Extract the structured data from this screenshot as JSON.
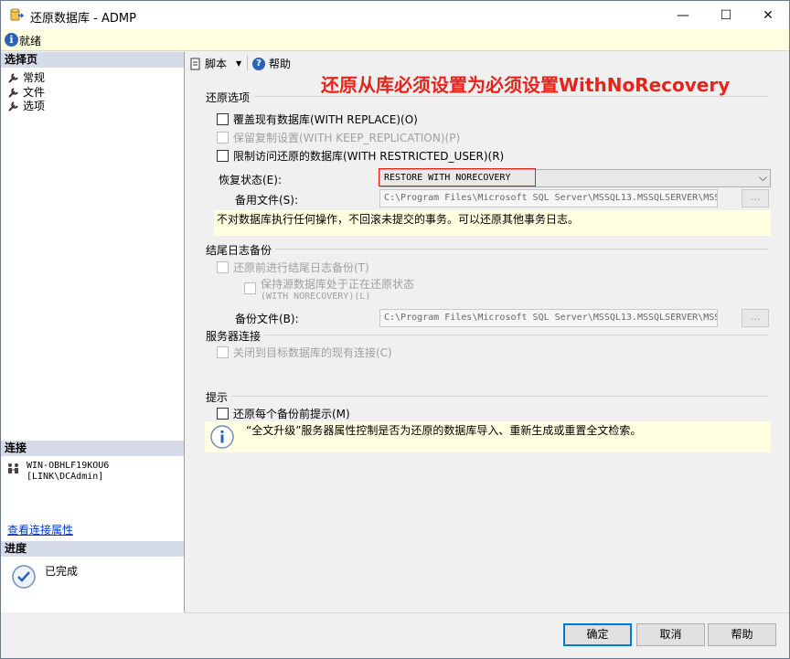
{
  "window": {
    "title": "还原数据库 - ADMP"
  },
  "status": {
    "text": "就绪"
  },
  "left": {
    "select_page_header": "选择页",
    "nav": [
      {
        "label": "常规"
      },
      {
        "label": "文件"
      },
      {
        "label": "选项"
      }
    ],
    "connection_header": "连接",
    "connection_server": "WIN-OBHLF19KOU6",
    "connection_user": "[LINK\\DCAdmin]",
    "connection_props_link": "查看连接属性",
    "progress_header": "进度",
    "progress_status": "已完成"
  },
  "toolbar": {
    "script_label": "脚本",
    "help_label": "帮助"
  },
  "annotation": "还原从库必须设置为必须设置WithNoRecovery",
  "restore_options": {
    "group_label": "还原选项",
    "overwrite": "覆盖现有数据库(WITH REPLACE)(O)",
    "keep_replication": "保留复制设置(WITH KEEP_REPLICATION)(P)",
    "restrict_access": "限制访问还原的数据库(WITH RESTRICTED_USER)(R)",
    "recovery_state_label": "恢复状态(E):",
    "recovery_state_value": "RESTORE WITH NORECOVERY",
    "standby_file_label": "备用文件(S):",
    "standby_file_value": "C:\\Program Files\\Microsoft SQL Server\\MSSQL13.MSSQLSERVER\\MSS",
    "recovery_note": "不对数据库执行任何操作，不回滚未提交的事务。可以还原其他事务日志。"
  },
  "tail_log": {
    "group_label": "结尾日志备份",
    "backup_before": "还原前进行结尾日志备份(T)",
    "keep_source_line1": "保持源数据库处于正在还原状态",
    "keep_source_line2": "(WITH NORECOVERY)(L)",
    "backup_file_label": "备份文件(B):",
    "backup_file_value": "C:\\Program Files\\Microsoft SQL Server\\MSSQL13.MSSQLSERVER\\MSS"
  },
  "server_conn": {
    "group_label": "服务器连接",
    "close_existing": "关闭到目标数据库的现有连接(C)"
  },
  "prompt": {
    "group_label": "提示",
    "prompt_before": "还原每个备份前提示(M)",
    "info_text": "“全文升级”服务器属性控制是否为还原的数据库导入、重新生成或重置全文检索。"
  },
  "browse_label": "...",
  "buttons": {
    "ok": "确定",
    "cancel": "取消",
    "help": "帮助"
  },
  "colors": {
    "annotation": "#e8231c",
    "primary_border": "#0078d7",
    "status_bg": "#ffffe1"
  }
}
